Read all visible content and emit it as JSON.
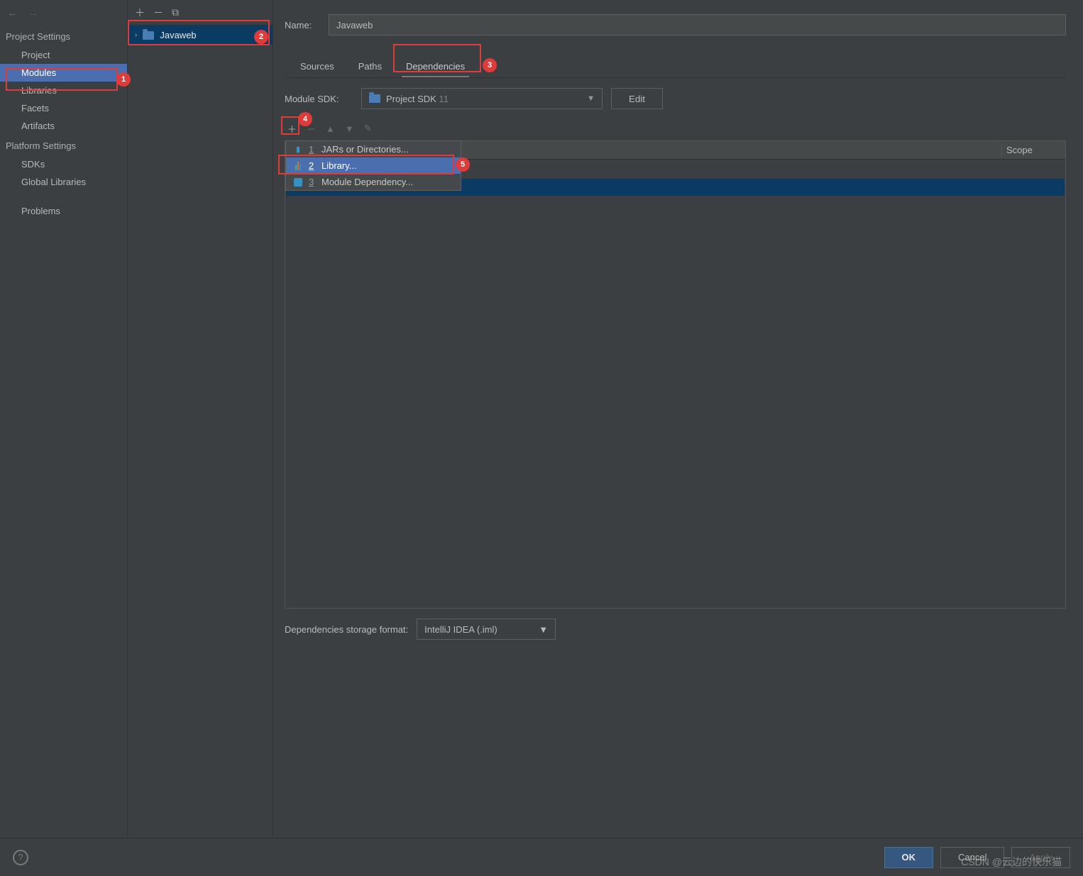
{
  "sidebar": {
    "section_project": "Project Settings",
    "items_project": [
      {
        "label": "Project"
      },
      {
        "label": "Modules"
      },
      {
        "label": "Libraries"
      },
      {
        "label": "Facets"
      },
      {
        "label": "Artifacts"
      }
    ],
    "section_platform": "Platform Settings",
    "items_platform": [
      {
        "label": "SDKs"
      },
      {
        "label": "Global Libraries"
      }
    ],
    "problems": "Problems"
  },
  "tree": {
    "module_name": "Javaweb"
  },
  "content": {
    "name_label": "Name:",
    "name_value": "Javaweb",
    "tabs": [
      {
        "label": "Sources"
      },
      {
        "label": "Paths"
      },
      {
        "label": "Dependencies"
      }
    ],
    "sdk_label": "Module SDK:",
    "sdk_value": "Project SDK",
    "sdk_version": "11",
    "edit_label": "Edit",
    "scope_label": "Scope",
    "add_menu": [
      {
        "key": "1",
        "label": "JARs or Directories..."
      },
      {
        "key": "2",
        "label": "Library..."
      },
      {
        "key": "3",
        "label": "Module Dependency..."
      }
    ],
    "storage_label": "Dependencies storage format:",
    "storage_value": "IntelliJ IDEA (.iml)"
  },
  "buttons": {
    "ok": "OK",
    "cancel": "Cancel",
    "apply": "Apply"
  },
  "annotations": {
    "b1": "1",
    "b2": "2",
    "b3": "3",
    "b4": "4",
    "b5": "5"
  },
  "watermark": "CSDN @云边的快乐猫"
}
